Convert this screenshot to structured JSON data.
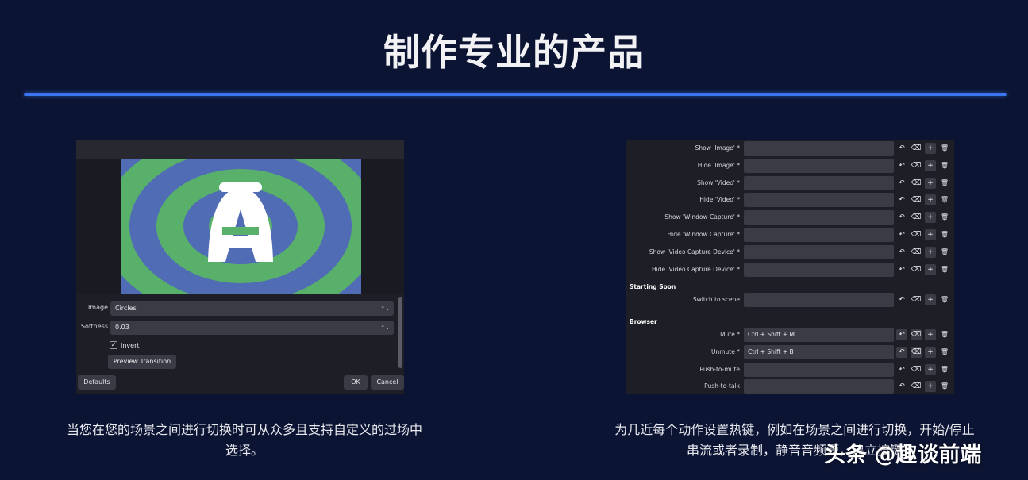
{
  "page": {
    "title": "制作专业的产品",
    "accent_color": "#3c74f0",
    "background_color": "#0c1433"
  },
  "left_panel": {
    "image_label": "Image",
    "image_value": "Circles",
    "softness_label": "Softness",
    "softness_value": "0.03",
    "invert_label": "Invert",
    "invert_checked": "✓",
    "preview_button": "Preview Transition",
    "defaults_button": "Defaults",
    "ok_button": "OK",
    "cancel_button": "Cancel",
    "logo_letter": "A"
  },
  "right_panel": {
    "rows_top": [
      {
        "label": "Show 'Image' *",
        "value": ""
      },
      {
        "label": "Hide 'Image' *",
        "value": ""
      },
      {
        "label": "Show 'Video' *",
        "value": ""
      },
      {
        "label": "Hide 'Video' *",
        "value": ""
      },
      {
        "label": "Show 'Window Capture' *",
        "value": ""
      },
      {
        "label": "Hide 'Window Capture' *",
        "value": ""
      },
      {
        "label": "Show 'Video Capture Device' *",
        "value": ""
      },
      {
        "label": "Hide 'Video Capture Device' *",
        "value": ""
      }
    ],
    "section_starting_soon": "Starting Soon",
    "switch_to_scene": {
      "label": "Switch to scene",
      "value": ""
    },
    "section_browser": "Browser",
    "rows_browser": [
      {
        "label": "Mute *",
        "value": "Ctrl + Shift + M"
      },
      {
        "label": "Unmute *",
        "value": "Ctrl + Shift + B"
      },
      {
        "label": "Push-to-mute",
        "value": ""
      },
      {
        "label": "Push-to-talk",
        "value": ""
      }
    ],
    "icons": {
      "revert": "↶",
      "clear": "⌫",
      "add": "+",
      "delete": "🗑"
    }
  },
  "captions": {
    "left": "当您在您的场景之间进行切换时可从众多且支持自定义的过场中选择。",
    "right": "为几近每个动作设置热键，例如在场景之间进行切换，开始/停止串流或者录制，静音音频源，建立按键"
  },
  "watermark": "头条 @趣谈前端"
}
